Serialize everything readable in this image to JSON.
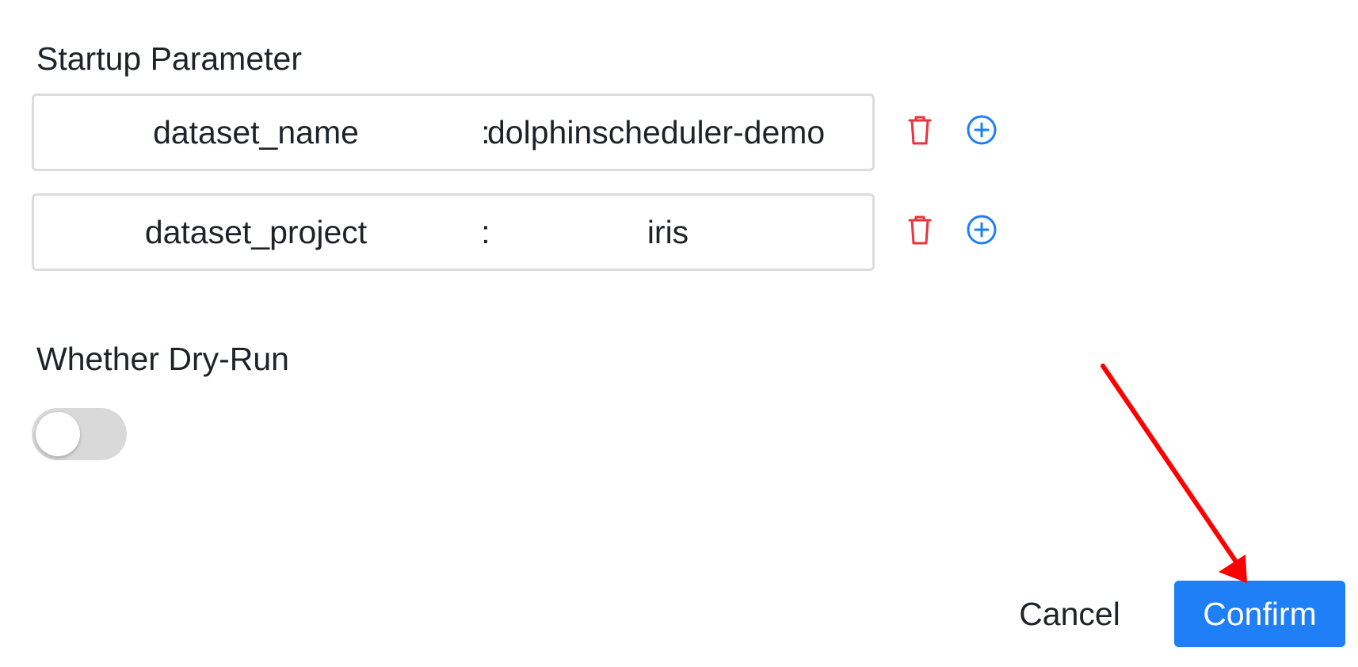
{
  "startup_parameter": {
    "label": "Startup Parameter",
    "rows": [
      {
        "key": "dataset_name",
        "separator": ":",
        "value": "dolphinscheduler-demo"
      },
      {
        "key": "dataset_project",
        "separator": ":",
        "value": "iris"
      }
    ]
  },
  "dry_run": {
    "label": "Whether Dry-Run",
    "enabled": false
  },
  "footer": {
    "cancel_label": "Cancel",
    "confirm_label": "Confirm"
  },
  "colors": {
    "primary": "#1e7ff6",
    "danger": "#e8353d",
    "annotation_arrow": "#ff0000"
  },
  "icons": {
    "delete": "trash-icon",
    "add": "plus-circle-icon"
  }
}
